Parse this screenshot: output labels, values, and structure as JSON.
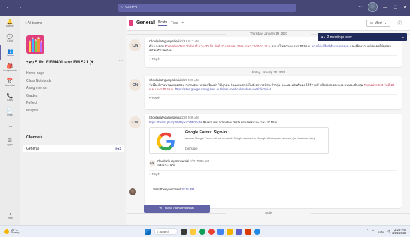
{
  "titlebar": {
    "search_placeholder": "Search",
    "more": "···",
    "minimize": "—",
    "maximize": "□",
    "close": "✕"
  },
  "appbar": {
    "items": [
      {
        "label": "Activity",
        "icon": "bell-icon",
        "glyph": "🔔"
      },
      {
        "label": "Chat",
        "icon": "chat-icon",
        "glyph": "💬"
      },
      {
        "label": "Teams",
        "icon": "teams-icon",
        "glyph": "👥"
      },
      {
        "label": "Assignments",
        "icon": "assignments-icon",
        "glyph": "🎒"
      },
      {
        "label": "Calendar",
        "icon": "calendar-icon",
        "glyph": "📅"
      },
      {
        "label": "Calls",
        "icon": "phone-icon",
        "glyph": "📞"
      },
      {
        "label": "Files",
        "icon": "file-icon",
        "glyph": "📄"
      },
      {
        "label": "···",
        "icon": "more-icon",
        "glyph": "···"
      },
      {
        "label": "Apps",
        "icon": "apps-icon",
        "glyph": "⊞"
      }
    ],
    "help": {
      "label": "Help",
      "icon": "help-icon",
      "glyph": "?"
    }
  },
  "team": {
    "all_teams": "All teams",
    "name": "รอบ 5 Ro.F FM401 และ FM 521 (9....",
    "more": "···",
    "links": [
      "Home page",
      "Class Notebook",
      "Assignments",
      "Grades",
      "Reflect",
      "Insights"
    ],
    "channels_label": "Channels",
    "channel": {
      "name": "General",
      "count": "2"
    }
  },
  "channel_header": {
    "title": "General",
    "tabs": [
      "Posts",
      "Files"
    ],
    "plus": "+",
    "meet_label": "Meet",
    "meeting_banner": "2 meetings now"
  },
  "feed": {
    "date1": "Thursday, January 19, 2023",
    "date2": "Friday, January 20, 2023",
    "date3": "Today",
    "reply_label": "Reply",
    "posts": [
      {
        "initials": "CN",
        "author": "Chonlada Ngamprakaisi",
        "time": "1/19 9:17 AM",
        "text_a": "ทำแบบสอบ",
        "text_red": "Formative Test Online จำนวน 30 ข้อ วันที่ 20 มกราคม 2566 เวลา 11.00-11.30 น.",
        "text_b": "บนรถไฟสถานะเวลา 10.55 น.",
        "text_link": "ทางนี้ค่ะมีลิงก์ทำแบบทดสอบ",
        "text_c": "และเพื่อความพร้อม ขอให้ทุกคนเตรียมตัวให้พร้อม"
      },
      {
        "initials": "CN",
        "author": "Chonlada Ngamprakaisi",
        "time": "1/20 9:00 AM",
        "text_a": "วันนี้จะมีการทำแบบทดสอบ Formative test เตรียมตัว ให้ทุกคน ส่งแบบบอกต่อไปยังอาจารย์ประจำกลุ่ม และประเมินตัวเอง ได้ทำ self reflection ต่อทางระบบประจำกลุ่ม",
        "text_red": "Formative test วันที่ 20 ม.ค. เวลา 10.55 น.",
        "text_link": "https://sites.google.com/g.swu.ac.th/swu-medical-student-portfolio?pli=1"
      },
      {
        "initials": "CN",
        "author": "Chonlada Ngamprakaisi",
        "time": "1/20 9:00 AM",
        "text_link": "https://forms.gle/zp7WfNgxnTWFcFq1A",
        "text_a": "ลิงก์ทำแบบ Formative Test บนรถไฟสถานะเวลา 10.55 น.",
        "card_title": "Google Forms: Sign-in",
        "card_desc": "Access Google Forms with a personal Google account or Google Workspace account (for business use).",
        "card_url": "forms.gle",
        "nested": {
          "initials": "CN",
          "author": "Chonlada Ngamprakaisi",
          "time": "1/20 10:55 AM",
          "text": "รหัสผ่าน: 005"
        }
      }
    ],
    "partial_author": "Sirin Boonyaammarit",
    "partial_time": "12:29 PM",
    "new_conversation": "New conversation"
  },
  "taskbar": {
    "temp": "27°C",
    "weather": "Sunny",
    "search": "Search",
    "lang": "ENG",
    "time": "3:29 PM",
    "date": "1/23/2023"
  },
  "colors": {
    "titlebar": "#464775",
    "accent": "#6264a7",
    "banner": "#1f2a5a",
    "alert_red": "#c4314b",
    "team_logo": "#e03e7d"
  }
}
